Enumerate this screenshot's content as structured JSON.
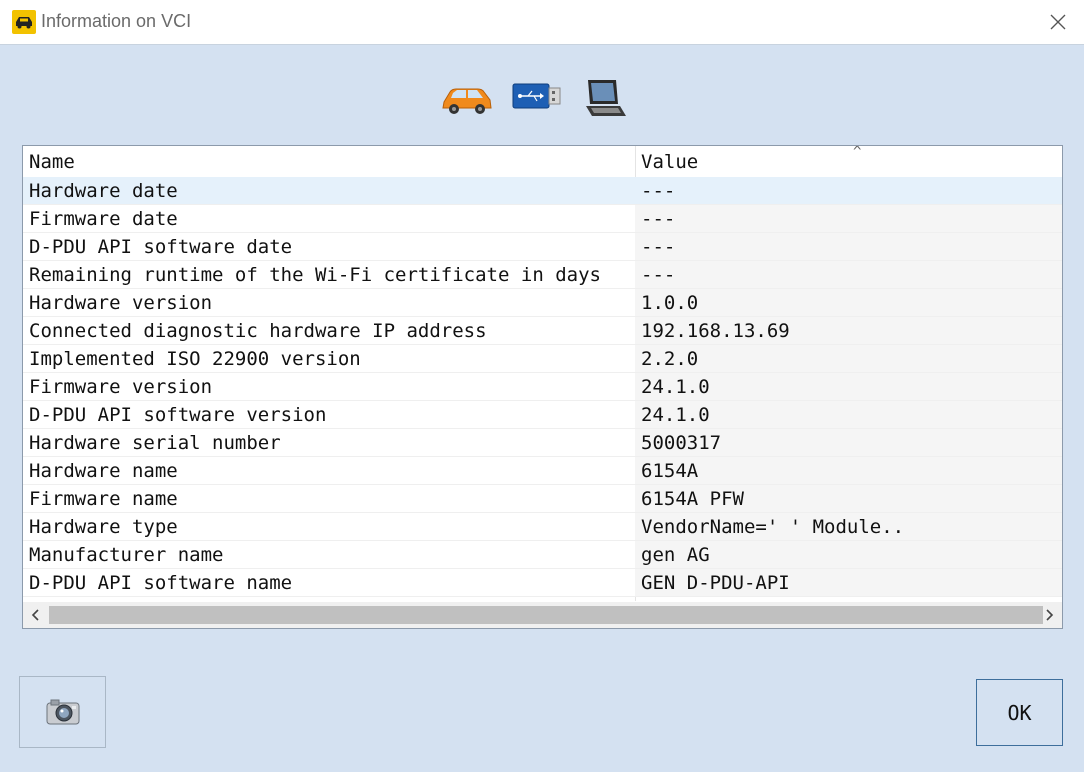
{
  "window": {
    "title": "Information on VCI",
    "colors": {
      "background": "#d4e1f1",
      "selected_row": "#e5f1fb",
      "app_icon": "#f2c200"
    }
  },
  "toolbar": {
    "icons": [
      "car-icon",
      "usb-icon",
      "laptop-icon"
    ]
  },
  "table": {
    "columns": [
      "Name",
      "Value"
    ],
    "rows": [
      {
        "name": "Hardware date",
        "value": "---"
      },
      {
        "name": "Firmware date",
        "value": "---"
      },
      {
        "name": "D-PDU API software date",
        "value": "---"
      },
      {
        "name": "Remaining runtime of the Wi-Fi certificate in days",
        "value": "---"
      },
      {
        "name": "Hardware version",
        "value": "1.0.0"
      },
      {
        "name": "Connected diagnostic hardware IP address",
        "value": "192.168.13.69"
      },
      {
        "name": "Implemented ISO 22900 version",
        "value": "2.2.0"
      },
      {
        "name": "Firmware version",
        "value": "24.1.0"
      },
      {
        "name": "D-PDU API software version",
        "value": "24.1.0"
      },
      {
        "name": "Hardware serial number",
        "value": "5000317"
      },
      {
        "name": "Hardware name",
        "value": "  6154A"
      },
      {
        "name": "Firmware name",
        "value": "  6154A PFW"
      },
      {
        "name": "Hardware type",
        "value": "VendorName='               ' Module.."
      },
      {
        "name": "Manufacturer name",
        "value": "     gen AG"
      },
      {
        "name": "D-PDU API software name",
        "value": "      GEN D-PDU-API"
      }
    ]
  },
  "buttons": {
    "ok_label": "OK",
    "screenshot_icon": "camera-icon"
  }
}
